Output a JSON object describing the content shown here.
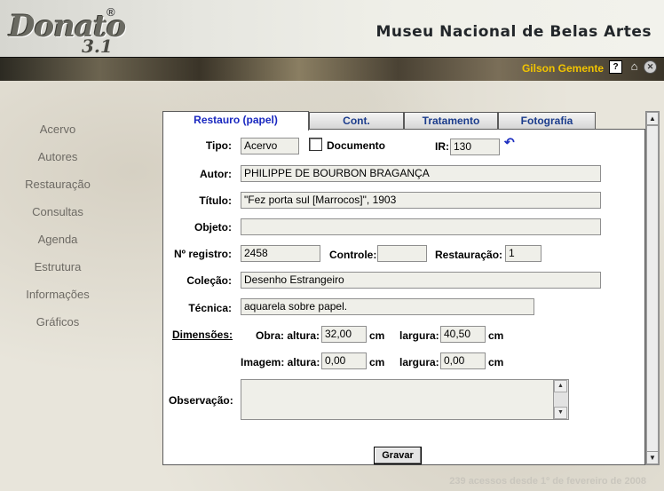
{
  "header": {
    "logo_text": "Donato",
    "logo_version": "3.1",
    "logo_reg": "®",
    "title": "Museu Nacional de Belas Artes",
    "user": "Gilson Gemente",
    "help_glyph": "?",
    "home_glyph": "⌂",
    "close_glyph": "✕"
  },
  "sidebar": {
    "items": [
      {
        "label": "Acervo"
      },
      {
        "label": "Autores"
      },
      {
        "label": "Restauração"
      },
      {
        "label": "Consultas"
      },
      {
        "label": "Agenda"
      },
      {
        "label": "Estrutura"
      },
      {
        "label": "Informações"
      },
      {
        "label": "Gráficos"
      }
    ]
  },
  "tabs": [
    {
      "label": "Restauro (papel)",
      "active": true
    },
    {
      "label": "Cont."
    },
    {
      "label": "Tratamento"
    },
    {
      "label": "Fotografia"
    }
  ],
  "form": {
    "tipo_label": "Tipo:",
    "tipo_value": "Acervo",
    "documento_label": "Documento",
    "documento_checked": false,
    "ir_label": "IR:",
    "ir_value": "130",
    "autor_label": "Autor:",
    "autor_value": "PHILIPPE DE BOURBON BRAGANÇA",
    "titulo_label": "Título:",
    "titulo_value": "\"Fez porta sul [Marrocos]\", 1903",
    "objeto_label": "Objeto:",
    "objeto_value": "",
    "registro_label": "Nº registro:",
    "registro_value": "2458",
    "controle_label": "Controle:",
    "controle_value": "",
    "restauracao_label": "Restauração:",
    "restauracao_value": "1",
    "colecao_label": "Coleção:",
    "colecao_value": "Desenho Estrangeiro",
    "tecnica_label": "Técnica:",
    "tecnica_value": "aquarela sobre papel.",
    "dimensoes_label": "Dimensões:",
    "obra_altura_label": "Obra: altura:",
    "obra_altura_value": "32,00",
    "obra_largura_label": "largura:",
    "obra_largura_value": "40,50",
    "imagem_altura_label": "Imagem: altura:",
    "imagem_altura_value": "0,00",
    "imagem_largura_label": "largura:",
    "imagem_largura_value": "0,00",
    "unit": "cm",
    "observacao_label": "Observação:",
    "observacao_value": "",
    "save_label": "Gravar"
  },
  "footer": {
    "text": "239 acessos desde 1º de fevereiro de 2008"
  },
  "colors": {
    "user_name": "#f2c400",
    "tab_text": "#1b3c8c",
    "sidebar_text": "#6d6a64"
  }
}
